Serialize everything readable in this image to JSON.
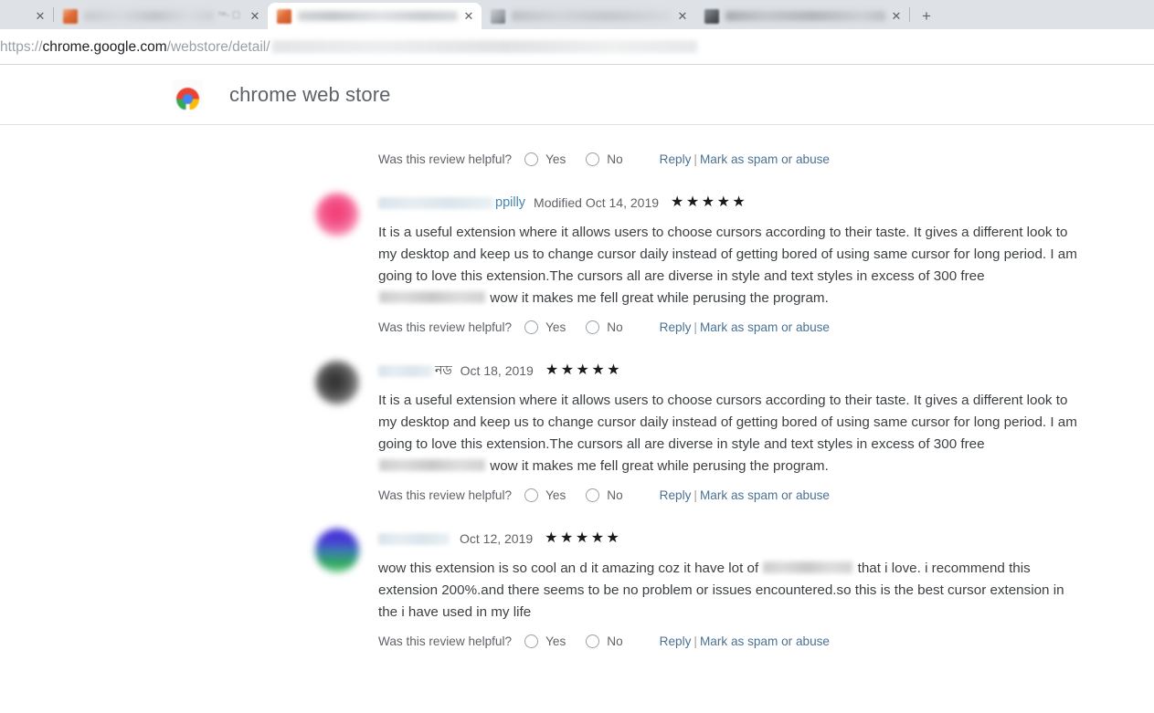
{
  "browser": {
    "tabs": [
      {
        "title_redacted": true,
        "favicon": "orange-favicon",
        "extra_text": "™- ☐",
        "close_label": "✕",
        "state": "partial"
      },
      {
        "title_redacted": true,
        "favicon": "orange-favicon",
        "extra_text": "",
        "close_label": "✕",
        "state": "active"
      },
      {
        "title_redacted": true,
        "favicon": "grey-favicon",
        "extra_text": "",
        "close_label": "✕",
        "state": "inactive"
      },
      {
        "title_redacted": true,
        "favicon": "dark-favicon",
        "extra_text": "",
        "close_label": "✕",
        "state": "inactive"
      }
    ],
    "new_tab_label": "+",
    "url": {
      "scheme": "https://",
      "host": "chrome.google.com",
      "path": "/webstore/detail/",
      "remainder_redacted": true
    }
  },
  "site": {
    "logo_name": "chrome-web-store-logo",
    "title": "chrome web store"
  },
  "helpful": {
    "question": "Was this review helpful?",
    "yes_label": "Yes",
    "no_label": "No",
    "reply_label": "Reply",
    "separator": "|",
    "spam_label": "Mark as spam or abuse"
  },
  "reviews": [
    {
      "id": "review-partial-top",
      "partial": true,
      "author_prefix_redacted": false,
      "author_name": "",
      "date": "",
      "stars": "",
      "text_before": "",
      "text_after": "",
      "avatar_class": ""
    },
    {
      "id": "review-ppilly",
      "partial": false,
      "avatar_class": "av-pink",
      "avatar_name": "avatar-pink",
      "redact_width_class": "w1",
      "author_name": "ppilly",
      "author_is_bengali": false,
      "date": "Modified Oct 14, 2019",
      "stars": "★★★★★",
      "star_count": 5,
      "text_before": "It is a useful extension where it allows users to choose cursors according to their taste. It gives a different look to my  desktop and keep us to change cursor daily instead of getting bored of using same cursor for long period. I am going to love this extension.The cursors all are diverse in style and text styles in excess of 300 free ",
      "text_after": " wow it makes me fell great while perusing the program.",
      "has_inline_redaction": true
    },
    {
      "id": "review-bengali",
      "partial": false,
      "avatar_class": "av-dark",
      "avatar_name": "avatar-dark",
      "redact_width_class": "w2",
      "author_name": "নড",
      "author_is_bengali": true,
      "date": "Oct 18, 2019",
      "stars": "★★★★★",
      "star_count": 5,
      "text_before": "It is a useful extension where it allows users to choose cursors according to their taste. It gives a different look to my  desktop and keep us to change cursor daily instead of getting bored of using same cursor for long period. I am going to love this extension.The cursors all are diverse in style and text styles in excess of 300 free ",
      "text_after": " wow it makes me fell great while perusing the program.",
      "has_inline_redaction": true
    },
    {
      "id": "review-oct12",
      "partial": false,
      "avatar_class": "av-bluegreen",
      "avatar_name": "avatar-blue-green",
      "redact_width_class": "w3",
      "author_name": "",
      "author_is_bengali": false,
      "date": "Oct 12, 2019",
      "stars": "★★★★★",
      "star_count": 5,
      "text_before": "wow this extension is so cool an d it amazing coz it have lot of ",
      "text_after": " that i love. i recommend this extension 200%.and there seems to be no problem or issues encountered.so this is the best cursor extension in the i have used in my life",
      "has_inline_redaction": true
    }
  ],
  "colors": {
    "link": "#4a7294",
    "author_link": "#4285b4",
    "text": "#3c4043",
    "muted": "#5f6368",
    "tabstrip_bg": "#dee1e6"
  }
}
